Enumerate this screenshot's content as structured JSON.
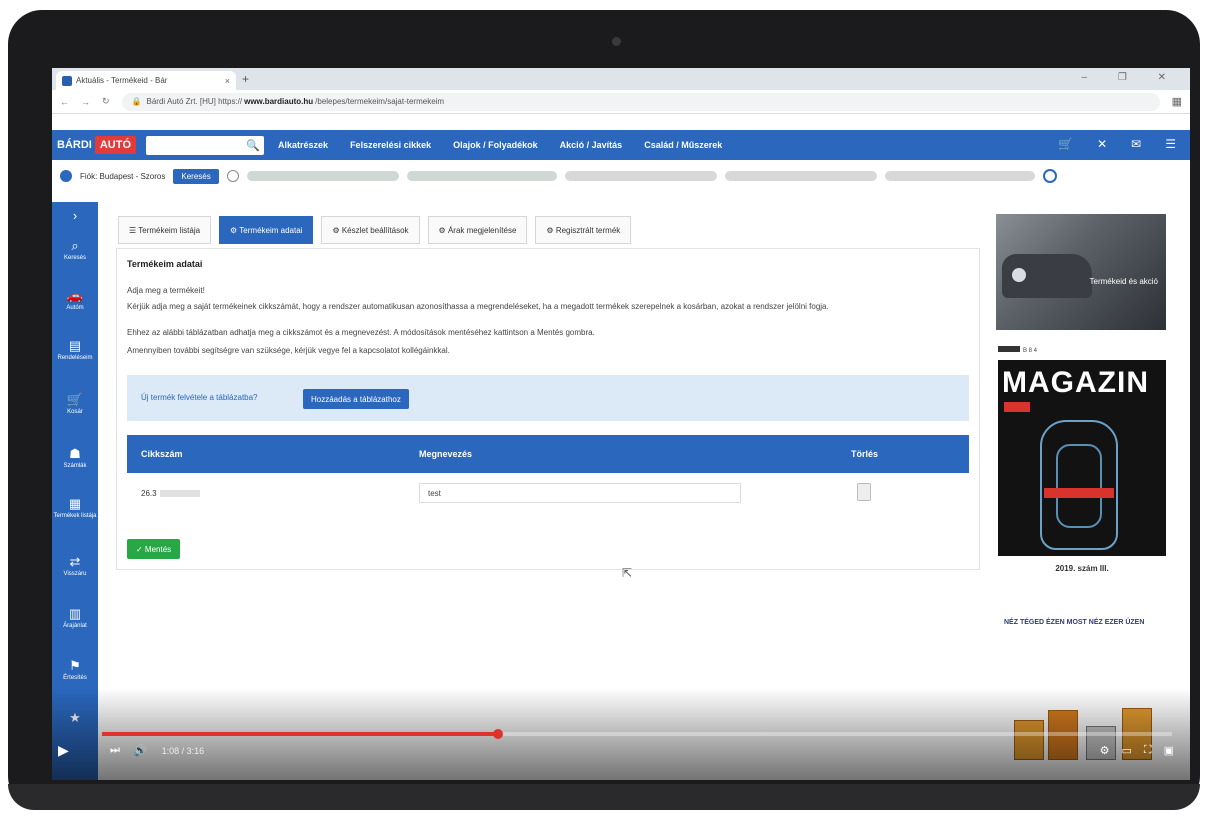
{
  "browser": {
    "tab_title": "Aktuális - Termékeid - Bár",
    "tab_close": "×",
    "new_tab": "+",
    "window_controls": "–  ❐  ✕",
    "nav_back": "←",
    "nav_forward": "→",
    "nav_reload": "↻",
    "url_prefix": "Bárdi Autó Zrt. [HU]  https://",
    "url_domain": "www.bardiauto.hu",
    "url_path": "/belepes/termekeim/sajat-termekeim",
    "extension_icon": "▦"
  },
  "site_header": {
    "logo_left": "BÁRDI",
    "logo_right": "AUTÓ",
    "search_icon": "🔍",
    "menu": [
      "Alkatrészek",
      "Felszerelési cikkek",
      "Olajok / Folyadékok",
      "Akció / Javítás",
      "Család / Műszerek"
    ],
    "icons": [
      "🛒",
      "✕",
      "✉",
      "☰"
    ]
  },
  "location_bar": {
    "label": "Fiók: Budapest - Szoros",
    "button": "Keresés"
  },
  "sidebar": {
    "items": [
      {
        "icon": "›",
        "label": ""
      },
      {
        "icon": "⌕",
        "label": "Keresés"
      },
      {
        "icon": "🚗",
        "label": "Autóm"
      },
      {
        "icon": "▤",
        "label": "Rendeléseim"
      },
      {
        "icon": "🛒",
        "label": "Kosár"
      },
      {
        "icon": "☗",
        "label": "Számlák"
      },
      {
        "icon": "▦",
        "label": "Termékek listája"
      },
      {
        "icon": "⇄",
        "label": "Visszáru"
      },
      {
        "icon": "▥",
        "label": "Árajánlat"
      },
      {
        "icon": "⚑",
        "label": "Értesítés"
      },
      {
        "icon": "★",
        "label": ""
      }
    ]
  },
  "content_tabs": [
    {
      "label": "☰ Termékeim listája",
      "active": false
    },
    {
      "label": "⚙ Termékeim adatai",
      "active": true
    },
    {
      "label": "⚙ Készlet beállítások",
      "active": false
    },
    {
      "label": "⚙ Árak megjelenítése",
      "active": false
    },
    {
      "label": "⚙ Regisztrált termék",
      "active": false
    }
  ],
  "panel": {
    "title": "Termékeim adatai",
    "line1": "Adja meg a termékeit!",
    "line2": "Kérjük adja meg a saját termékeinek cikkszámát, hogy a rendszer automatikusan azonosíthassa a megrendeléseket, ha a megadott termékek szerepelnek a kosárban, azokat a rendszer jelölni fogja.",
    "line3": "Ehhez az alábbi táblázatban adhatja meg a cikkszámot és a megnevezést. A módosítások mentéséhez kattintson a Mentés gombra.",
    "line4": "Amennyiben további segítségre van szüksége, kérjük vegye fel a kapcsolatot kollégáinkkal.",
    "note_question": "Új termék felvétele a táblázatba?",
    "note_button": "Hozzáadás a táblázathoz",
    "table_headers": {
      "code": "Cikkszám",
      "name": "Megnevezés",
      "delete": "Törlés"
    },
    "row": {
      "code": "26.3",
      "name": "test"
    },
    "save_button": "✓ Mentés"
  },
  "ads": {
    "car_text": "Termékeid és akció",
    "mag_bar": "B 8 4",
    "magazine_title": "MAGAZIN",
    "magazine_issue": "2019. szám III.",
    "promo_text": "NÉZ TÉGED ÉZEN MOST NÉZ EZER ÜZEN"
  },
  "video": {
    "progress_fraction": 0.37,
    "time": "1:08 / 3:16",
    "play_icon": "▶",
    "next_icon": "⏭",
    "volume_icon": "🔊",
    "right_icons": [
      "⚙",
      "▭",
      "⛶",
      "▣"
    ]
  },
  "colors": {
    "brand_blue": "#2a67bd",
    "brand_red": "#e33b3b",
    "success": "#28a745",
    "progress_red": "#e0322d"
  }
}
